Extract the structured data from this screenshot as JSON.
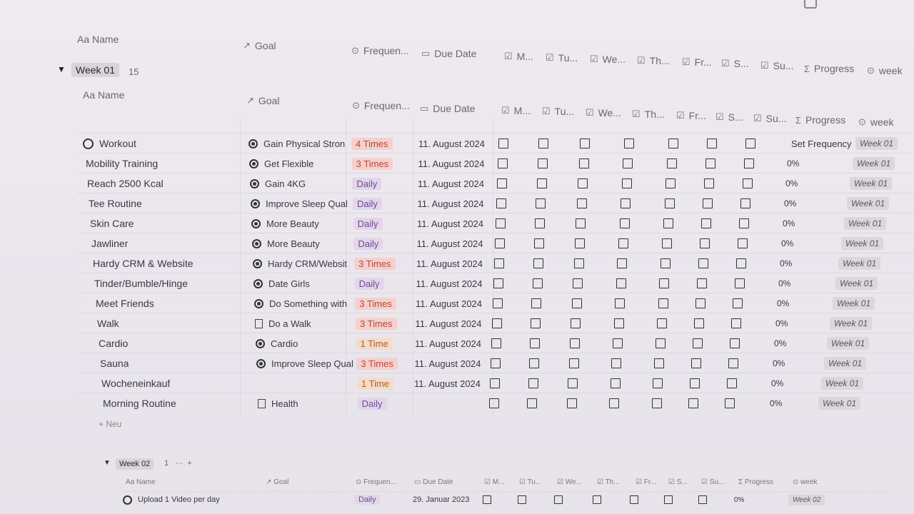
{
  "columns": {
    "name": "Aa Name",
    "goal": "Goal",
    "frequency": "Frequen...",
    "due_date": "Due Date",
    "mon": "M...",
    "tue": "Tu...",
    "wed": "We...",
    "thu": "Th...",
    "fri": "Fr...",
    "sat": "S...",
    "sun": "Su...",
    "progress": "Progress",
    "week": "week"
  },
  "group1": {
    "label": "Week 01",
    "count": "15",
    "set_frequency": "Set Frequency",
    "rows": [
      {
        "name": "Workout",
        "goal": "Gain Physical Stron",
        "goal_icon": "target-icon",
        "freq": "4 Times",
        "due": "11. August 2024",
        "progress": "",
        "week": "Week 01"
      },
      {
        "name": "Mobility Training",
        "goal": "Get Flexible",
        "goal_icon": "target-icon",
        "freq": "3 Times",
        "due": "11. August 2024",
        "progress": "0%",
        "week": "Week 01"
      },
      {
        "name": "Reach 2500 Kcal",
        "goal": "Gain 4KG",
        "goal_icon": "target-icon",
        "freq": "Daily",
        "due": "11. August 2024",
        "progress": "0%",
        "week": "Week 01"
      },
      {
        "name": "Tee Routine",
        "goal": "Improve Sleep Qual",
        "goal_icon": "target-icon",
        "freq": "Daily",
        "due": "11. August 2024",
        "progress": "0%",
        "week": "Week 01"
      },
      {
        "name": "Skin Care",
        "goal": "More Beauty",
        "goal_icon": "target-icon",
        "freq": "Daily",
        "due": "11. August 2024",
        "progress": "0%",
        "week": "Week 01"
      },
      {
        "name": "Jawliner",
        "goal": "More Beauty",
        "goal_icon": "target-icon",
        "freq": "Daily",
        "due": "11. August 2024",
        "progress": "0%",
        "week": "Week 01"
      },
      {
        "name": "Hardy CRM & Website",
        "goal": "Hardy CRM/Websit",
        "goal_icon": "target-icon",
        "freq": "3 Times",
        "due": "11. August 2024",
        "progress": "0%",
        "week": "Week 01"
      },
      {
        "name": "Tinder/Bumble/Hinge",
        "goal": "Date Girls",
        "goal_icon": "target-icon",
        "freq": "Daily",
        "due": "11. August 2024",
        "progress": "0%",
        "week": "Week 01"
      },
      {
        "name": "Meet Friends",
        "goal": "Do Something with",
        "goal_icon": "target-icon",
        "freq": "3 Times",
        "due": "11. August 2024",
        "progress": "0%",
        "week": "Week 01"
      },
      {
        "name": "Walk",
        "goal": "Do a Walk",
        "goal_icon": "doc-icon",
        "freq": "3 Times",
        "due": "11. August 2024",
        "progress": "0%",
        "week": "Week 01"
      },
      {
        "name": "Cardio",
        "goal": "Cardio",
        "goal_icon": "target-icon",
        "freq": "1 Time",
        "due": "11. August 2024",
        "progress": "0%",
        "week": "Week 01"
      },
      {
        "name": "Sauna",
        "goal": "Improve Sleep Qual",
        "goal_icon": "target-icon",
        "freq": "3 Times",
        "due": "11. August 2024",
        "progress": "0%",
        "week": "Week 01"
      },
      {
        "name": "Wocheneinkauf",
        "goal": "",
        "goal_icon": "",
        "freq": "1 Time",
        "due": "11. August 2024",
        "progress": "0%",
        "week": "Week 01"
      },
      {
        "name": "Morning Routine",
        "goal": "Health",
        "goal_icon": "doc-icon",
        "freq": "Daily",
        "due": "",
        "progress": "0%",
        "week": "Week 01"
      }
    ],
    "new_label": "+ Neu"
  },
  "group2": {
    "label": "Week 02",
    "count": "1",
    "more": "···",
    "add": "+",
    "row": {
      "name": "Upload 1 Video per day",
      "freq": "Daily",
      "due": "29. Januar 2023",
      "progress": "0%",
      "week": "Week 02"
    }
  }
}
